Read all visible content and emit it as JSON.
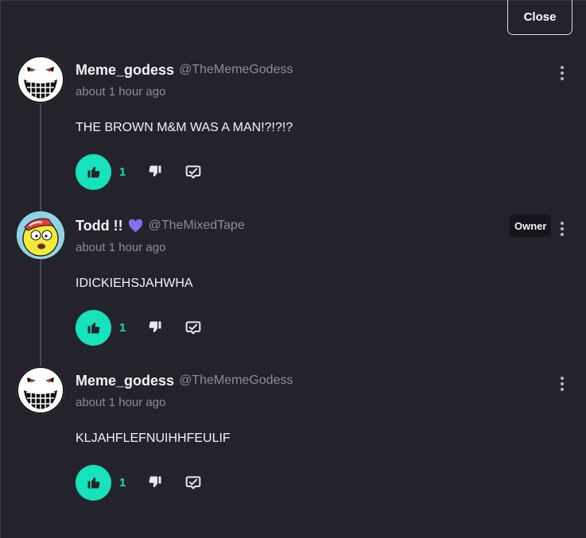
{
  "close_label": "Close",
  "accent": "#16e2bb",
  "comments": [
    {
      "display_name": "Meme_godess",
      "handle": "@TheMemeGodess",
      "timestamp": "about 1 hour ago",
      "text": "THE BROWN M&M WAS A MAN!?!?!?",
      "likes": "1",
      "avatar": "grinning-face-avatar",
      "badge": null
    },
    {
      "display_name": "Todd !!",
      "handle": "@TheMixedTape",
      "timestamp": "about 1 hour ago",
      "text": "IDICKIEHSJAHWHA",
      "likes": "1",
      "avatar": "cartoon-character-avatar",
      "badge": "Owner",
      "name_icon": "purple-heart-icon"
    },
    {
      "display_name": "Meme_godess",
      "handle": "@TheMemeGodess",
      "timestamp": "about 1 hour ago",
      "text": "KLJAHFLEFNUIHHFEULIF",
      "likes": "1",
      "avatar": "grinning-face-avatar",
      "badge": null
    }
  ]
}
